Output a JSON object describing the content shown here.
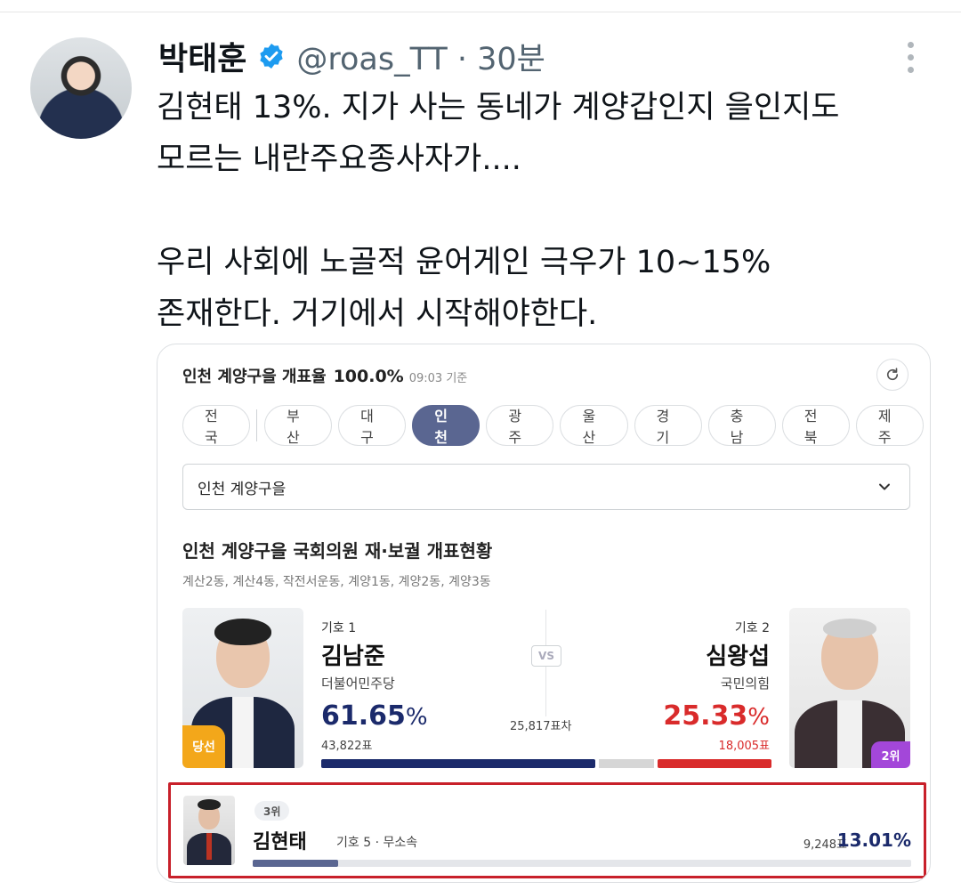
{
  "tweet": {
    "author_name": "박태훈",
    "handle": "@roas_TT · 30분",
    "text": "김현태 13%. 지가 사는 동네가 계양갑인지 을인지도\n모르는 내란주요종사자가....\n\n우리 사회에 노골적 윤어게인 극우가 10~15%\n존재한다. 거기에서 시작해야한다.",
    "icons": {
      "verified": "verified-badge-icon",
      "more": "more-vertical-icon"
    },
    "colors": {
      "verified": "#1d9bf0",
      "handle": "#536471"
    }
  },
  "card": {
    "title": "인천 계양구을 개표율",
    "rate": "100.0%",
    "time": "09:03 기준",
    "regions": [
      {
        "label": "전국",
        "active": false
      },
      {
        "label": "부산",
        "active": false
      },
      {
        "label": "대구",
        "active": false
      },
      {
        "label": "인천",
        "active": true
      },
      {
        "label": "광주",
        "active": false
      },
      {
        "label": "울산",
        "active": false
      },
      {
        "label": "경기",
        "active": false
      },
      {
        "label": "충남",
        "active": false
      },
      {
        "label": "전북",
        "active": false
      },
      {
        "label": "제주",
        "active": false
      }
    ],
    "district_select": "인천 계양구을",
    "section_title": "인천 계양구을 국회의원 재·보궐 개표현황",
    "section_sub": "계산2동, 계산4동, 작전서운동, 계양1동, 계양2동, 계양3동",
    "vs": "VS",
    "difference": "25,817표차",
    "candidates": [
      {
        "number": "기호 1",
        "name": "김남준",
        "party": "더불어민주당",
        "percent": "61.65",
        "percent_sign": "%",
        "votes": "43,822표",
        "badge": "당선",
        "share": 61.65,
        "color": "#1b2a6b"
      },
      {
        "number": "기호 2",
        "name": "심왕섭",
        "party": "국민의힘",
        "percent": "25.33",
        "percent_sign": "%",
        "votes": "18,005표",
        "badge": "2위",
        "share": 25.33,
        "color": "#d92b2b"
      }
    ],
    "third": {
      "rank": "3위",
      "name": "김현태",
      "meta": "기호 5 · 무소속",
      "votes": "9,248표",
      "percent": "13.01%",
      "share": 13.01,
      "highlight_color": "#c8202a"
    }
  }
}
